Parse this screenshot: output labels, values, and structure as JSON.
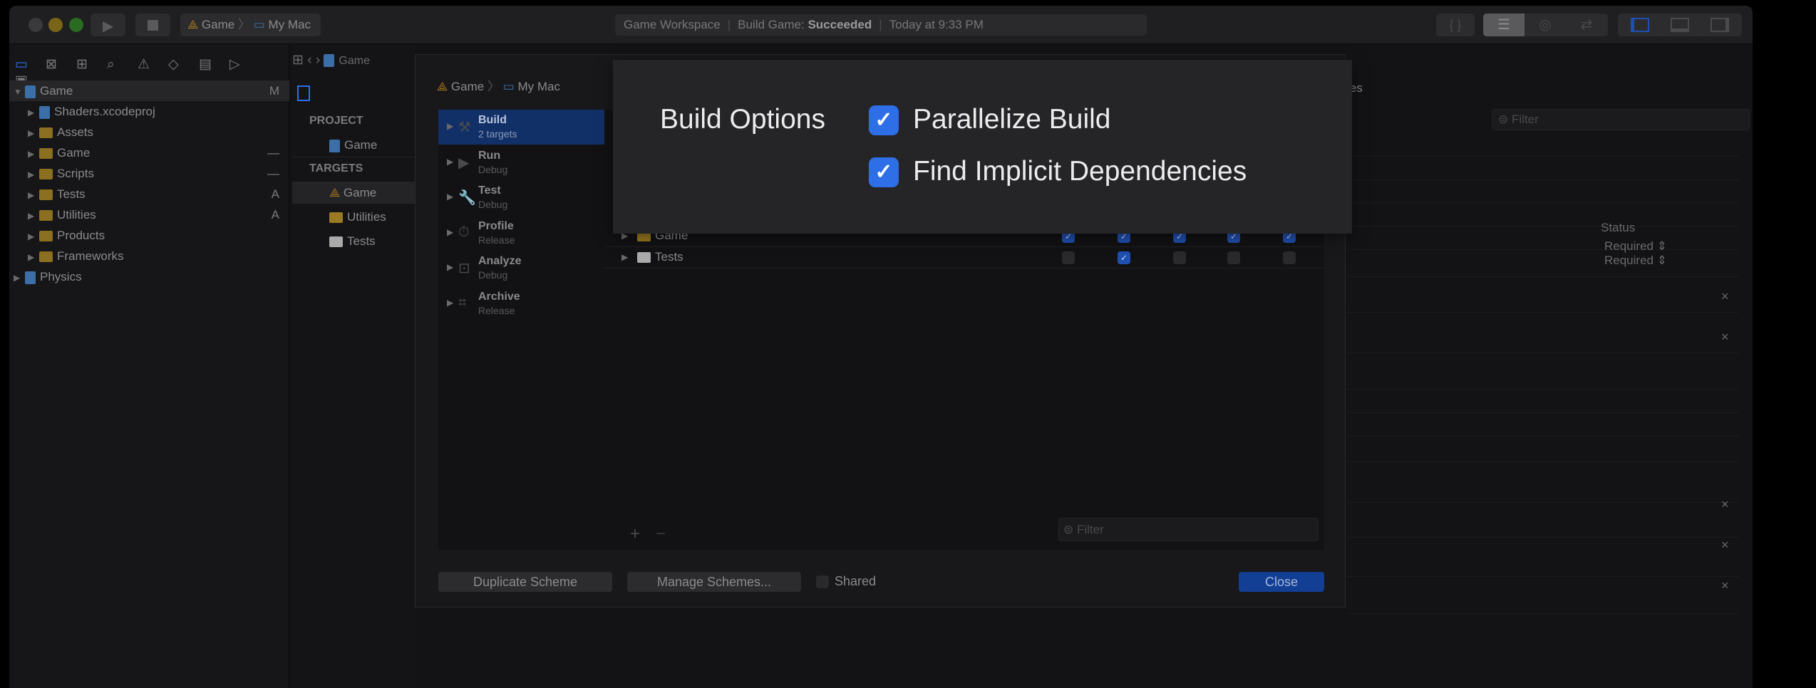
{
  "toolbar": {
    "scheme": {
      "target": "Game",
      "destination": "My Mac"
    },
    "status": {
      "workspace": "Game Workspace",
      "build_label": "Build Game:",
      "build_result": "Succeeded",
      "time": "Today at 9:33 PM"
    }
  },
  "navigator": {
    "items": [
      {
        "label": "Game",
        "badge": "M",
        "kind": "project",
        "level": 0,
        "expanded": true
      },
      {
        "label": "Shaders.xcodeproj",
        "badge": "",
        "kind": "project",
        "level": 1
      },
      {
        "label": "Assets",
        "badge": "",
        "kind": "folder",
        "level": 1
      },
      {
        "label": "Game",
        "badge": "—",
        "kind": "folder",
        "level": 1
      },
      {
        "label": "Scripts",
        "badge": "—",
        "kind": "folder",
        "level": 1
      },
      {
        "label": "Tests",
        "badge": "A",
        "kind": "folder",
        "level": 1
      },
      {
        "label": "Utilities",
        "badge": "A",
        "kind": "folder",
        "level": 1
      },
      {
        "label": "Products",
        "badge": "",
        "kind": "folder",
        "level": 1
      },
      {
        "label": "Frameworks",
        "badge": "",
        "kind": "folder",
        "level": 1
      },
      {
        "label": "Physics",
        "badge": "",
        "kind": "project",
        "level": 0
      }
    ]
  },
  "jumpbar": {
    "file": "Game"
  },
  "project_list": {
    "project_header": "PROJECT",
    "project": "Game",
    "targets_header": "TARGETS",
    "targets": [
      "Game",
      "Utilities",
      "Tests"
    ]
  },
  "sheet": {
    "breadcrumb": {
      "target": "Game",
      "destination": "My Mac"
    },
    "actions": [
      {
        "title": "Build",
        "subtitle": "2 targets",
        "selected": true
      },
      {
        "title": "Run",
        "subtitle": "Debug"
      },
      {
        "title": "Test",
        "subtitle": "Debug"
      },
      {
        "title": "Profile",
        "subtitle": "Release"
      },
      {
        "title": "Analyze",
        "subtitle": "Debug"
      },
      {
        "title": "Archive",
        "subtitle": "Release"
      }
    ],
    "targets": [
      {
        "name": "Game",
        "checks": [
          true,
          true,
          true,
          true,
          true
        ]
      },
      {
        "name": "Tests",
        "checks": [
          false,
          true,
          false,
          false,
          false
        ]
      }
    ],
    "add": "+",
    "remove": "−",
    "filter_placeholder": "Filter",
    "duplicate": "Duplicate Scheme",
    "manage": "Manage Schemes...",
    "shared": "Shared",
    "shared_checked": false,
    "close": "Close"
  },
  "popup": {
    "label": "Build Options",
    "options": [
      {
        "label": "Parallelize Build",
        "checked": true
      },
      {
        "label": "Find Implicit Dependencies",
        "checked": true
      }
    ]
  },
  "editor": {
    "partial_title": "les",
    "filter_placeholder": "Filter",
    "status_header": "Status",
    "status_values": [
      "Required",
      "Required"
    ]
  },
  "colors": {
    "accent": "#2e6fe8",
    "selection": "#123068",
    "close_button": "#123e94"
  }
}
